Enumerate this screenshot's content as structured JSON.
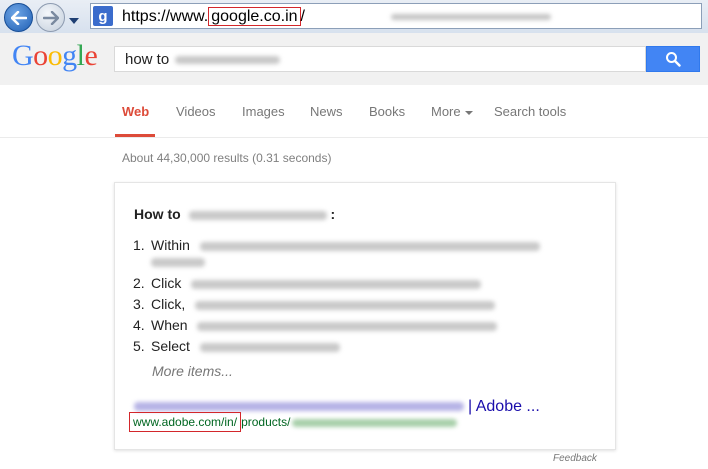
{
  "browser": {
    "favicon_letter": "g",
    "url_prefix": "https://www.",
    "url_domain": "google.co.in",
    "url_suffix": "/"
  },
  "header": {
    "logo": [
      "G",
      "o",
      "o",
      "g",
      "l",
      "e"
    ],
    "search_query": "how to"
  },
  "tabs": {
    "web": "Web",
    "videos": "Videos",
    "images": "Images",
    "news": "News",
    "books": "Books",
    "more": "More",
    "search_tools": "Search tools"
  },
  "stats": "About 44,30,000 results (0.31 seconds)",
  "answer_card": {
    "title_prefix": "How to",
    "title_suffix": ":",
    "steps": [
      {
        "num": "1.",
        "word": "Within"
      },
      {
        "num": "2.",
        "word": "Click"
      },
      {
        "num": "3.",
        "word": "Click,"
      },
      {
        "num": "4.",
        "word": "When"
      },
      {
        "num": "5.",
        "word": "Select"
      }
    ],
    "more_items": "More items...",
    "result_title_tail": "| Adobe ...",
    "result_url_boxed": "www.adobe.com/in/",
    "result_url_rest": "products/"
  },
  "footer": {
    "feedback": "Feedback"
  },
  "colors": {
    "accent_red": "#dd4b39",
    "link_blue": "#1a0dab",
    "url_green": "#006621",
    "search_blue": "#4285f4",
    "highlight_box": "#d3272b"
  }
}
